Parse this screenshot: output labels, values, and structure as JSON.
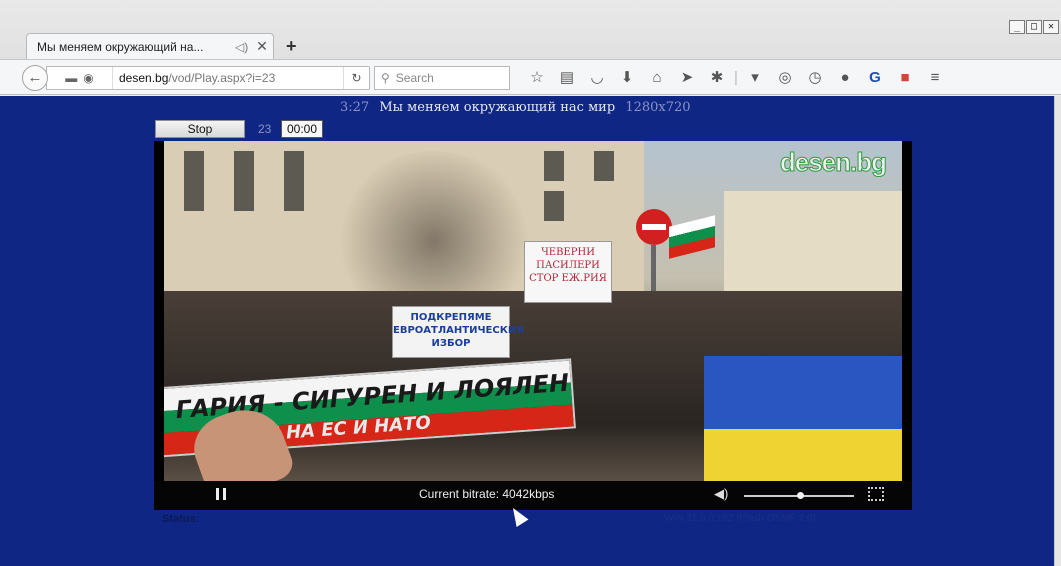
{
  "browser": {
    "tab": {
      "title": "Мы меняем окружающий на...",
      "close": "✕"
    },
    "new_tab": "+",
    "window_controls": {
      "minimize": "_",
      "maximize": "□",
      "close": "✕"
    },
    "url": {
      "domain": "desen.bg",
      "path": "/vod/Play.aspx?i=23"
    },
    "search_placeholder": "Search",
    "toolbar_icons": [
      "star-icon",
      "reading-list-icon",
      "pocket-icon",
      "download-icon",
      "home-icon",
      "send-icon",
      "extension-icon",
      "dropdown-icon",
      "record-icon",
      "clock-icon",
      "chat-icon",
      "translate-icon",
      "addon-icon",
      "menu-icon"
    ]
  },
  "page": {
    "duration": "3:27",
    "video_title": "Мы меняем окружающий нас мир",
    "resolution": "1280x720",
    "stop_label": "Stop",
    "counter": "23",
    "time": "00:00",
    "status_label": "Status:",
    "version": "WIN 21,0,0,182 (Flash OSMF 2.0)"
  },
  "video": {
    "logo": "desen.bg",
    "banner_text": "ГАРИЯ - СИГУРЕН И ЛОЯЛЕН",
    "banner_sub": "ЛЕН НА ЕС И НАТО",
    "sign_blue": "ПОДКРЕПЯМЕ ЕВРОАТЛАНТИЧЕСКИЯ ИЗБОР",
    "sign_red": "ЧЕВЕРНИ ПАСИЛЕРИ СТОР ЕЖ.РИЯ",
    "bitrate": "Current bitrate: 4042kbps",
    "volume_level": 0.5
  },
  "colors": {
    "page_bg": "#0f2685",
    "title_dim": "#8a93c4",
    "title_bright": "#e6e8f4"
  }
}
